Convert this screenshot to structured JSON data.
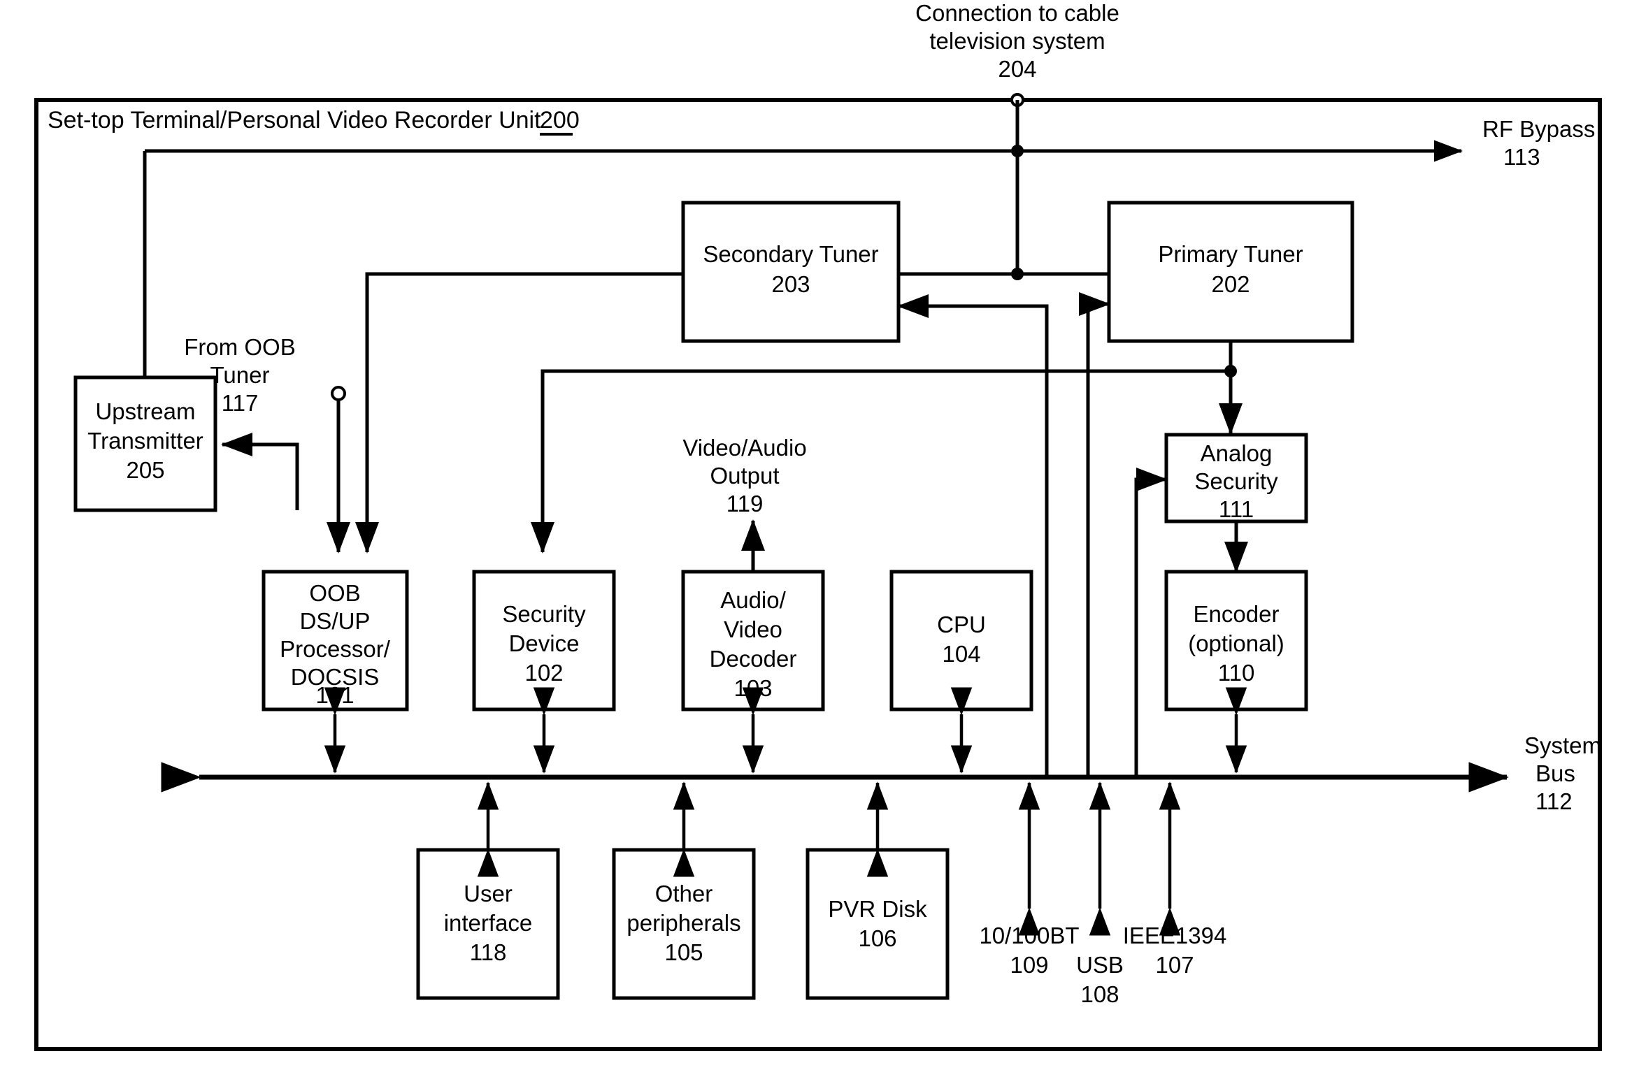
{
  "figure": {
    "title": "Set-top Terminal/Personal Video Recorder Unit",
    "title_ref": "200",
    "accent_color": "#000000",
    "background_color": "#ffffff"
  },
  "external": {
    "cable_connection": {
      "line1": "Connection to cable",
      "line2": "television system",
      "ref": "204"
    },
    "rf_bypass": {
      "label": "RF Bypass",
      "ref": "113"
    },
    "from_oob_tuner": {
      "line1": "From OOB",
      "line2": "Tuner",
      "ref": "117"
    },
    "video_audio_output": {
      "line1": "Video/Audio",
      "line2": "Output",
      "ref": "119"
    },
    "system_bus": {
      "line1": "System",
      "line2": "Bus",
      "ref": "112"
    }
  },
  "blocks": [
    {
      "id": "secondary_tuner",
      "lines": [
        "Secondary Tuner"
      ],
      "ref": "203"
    },
    {
      "id": "primary_tuner",
      "lines": [
        "Primary Tuner"
      ],
      "ref": "202"
    },
    {
      "id": "upstream_transmitter",
      "lines": [
        "Upstream",
        "Transmitter"
      ],
      "ref": "205"
    },
    {
      "id": "oob_processor",
      "lines": [
        "OOB",
        "DS/UP",
        "Processor/",
        "DOCSIS"
      ],
      "ref": "101"
    },
    {
      "id": "security_device",
      "lines": [
        "Security",
        "Device"
      ],
      "ref": "102"
    },
    {
      "id": "av_decoder",
      "lines": [
        "Audio/",
        "Video",
        "Decoder"
      ],
      "ref": "103"
    },
    {
      "id": "cpu",
      "lines": [
        "CPU"
      ],
      "ref": "104"
    },
    {
      "id": "analog_security",
      "lines": [
        "Analog",
        "Security"
      ],
      "ref": "111"
    },
    {
      "id": "encoder",
      "lines": [
        "Encoder",
        "(optional)"
      ],
      "ref": "110"
    },
    {
      "id": "user_interface",
      "lines": [
        "User",
        "interface"
      ],
      "ref": "118"
    },
    {
      "id": "other_peripherals",
      "lines": [
        "Other",
        "peripherals"
      ],
      "ref": "105"
    },
    {
      "id": "pvr_disk",
      "lines": [
        "PVR Disk"
      ],
      "ref": "106"
    }
  ],
  "bus_ports": [
    {
      "id": "port_10_100bt",
      "label": "10/100BT",
      "ref": "109"
    },
    {
      "id": "port_usb",
      "label": "USB",
      "ref": "108"
    },
    {
      "id": "port_ieee1394",
      "label": "IEEE1394",
      "ref": "107"
    }
  ],
  "block_text": {
    "secondary_tuner_l1": "Secondary Tuner",
    "secondary_tuner_ref": "203",
    "primary_tuner_l1": "Primary Tuner",
    "primary_tuner_ref": "202",
    "upstream_l1": "Upstream",
    "upstream_l2": "Transmitter",
    "upstream_ref": "205",
    "oob_l1": "OOB",
    "oob_l2": "DS/UP",
    "oob_l3": "Processor/",
    "oob_l4": "DOCSIS",
    "oob_ref": "101",
    "secdev_l1": "Security",
    "secdev_l2": "Device",
    "secdev_ref": "102",
    "avdec_l1": "Audio/",
    "avdec_l2": "Video",
    "avdec_l3": "Decoder",
    "avdec_ref": "103",
    "cpu_l1": "CPU",
    "cpu_ref": "104",
    "analogsec_l1": "Analog",
    "analogsec_l2": "Security",
    "analogsec_ref": "111",
    "encoder_l1": "Encoder",
    "encoder_l2": "(optional)",
    "encoder_ref": "110",
    "ui_l1": "User",
    "ui_l2": "interface",
    "ui_ref": "118",
    "periph_l1": "Other",
    "periph_l2": "peripherals",
    "periph_ref": "105",
    "pvr_l1": "PVR Disk",
    "pvr_ref": "106"
  },
  "port_text": {
    "bt_label": "10/100BT",
    "bt_ref": "109",
    "usb_label": "USB",
    "usb_ref": "108",
    "ieee_label": "IEEE1394",
    "ieee_ref": "107"
  }
}
